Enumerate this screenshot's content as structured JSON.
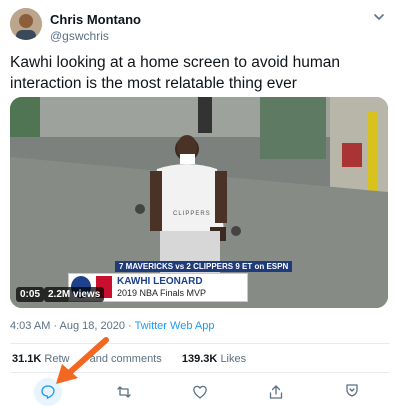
{
  "author": {
    "name": "Chris Montano",
    "handle": "@gswchris"
  },
  "tweet": {
    "text": "Kawhi looking at a home screen to avoid human interaction is the most relatable thing ever"
  },
  "video": {
    "ticker": "7 MAVERICKS vs 2 CLIPPERS 9 ET on ESPN",
    "player_name": "KAWHI LEONARD",
    "player_title": "2019 NBA Finals MVP",
    "shirt_text": "CLIPPERS",
    "duration": "0:05",
    "views": "2.2M views"
  },
  "meta": {
    "time": "4:03 AM · Aug 18, 2020 · ",
    "app": "Twitter Web App"
  },
  "stats": {
    "retweets_count": "31.1K",
    "retweets_label": "Retw",
    "quote_label": "and comments",
    "likes_count": "139.3K",
    "likes_label": "Likes"
  },
  "actions": {
    "reply": "reply-icon",
    "retweet": "retweet-icon",
    "like": "heart-icon",
    "share": "share-icon"
  },
  "colors": {
    "accent": "#1d9bf0",
    "arrow": "#f26722",
    "text": "#0f1419",
    "secondary": "#5b7083"
  }
}
